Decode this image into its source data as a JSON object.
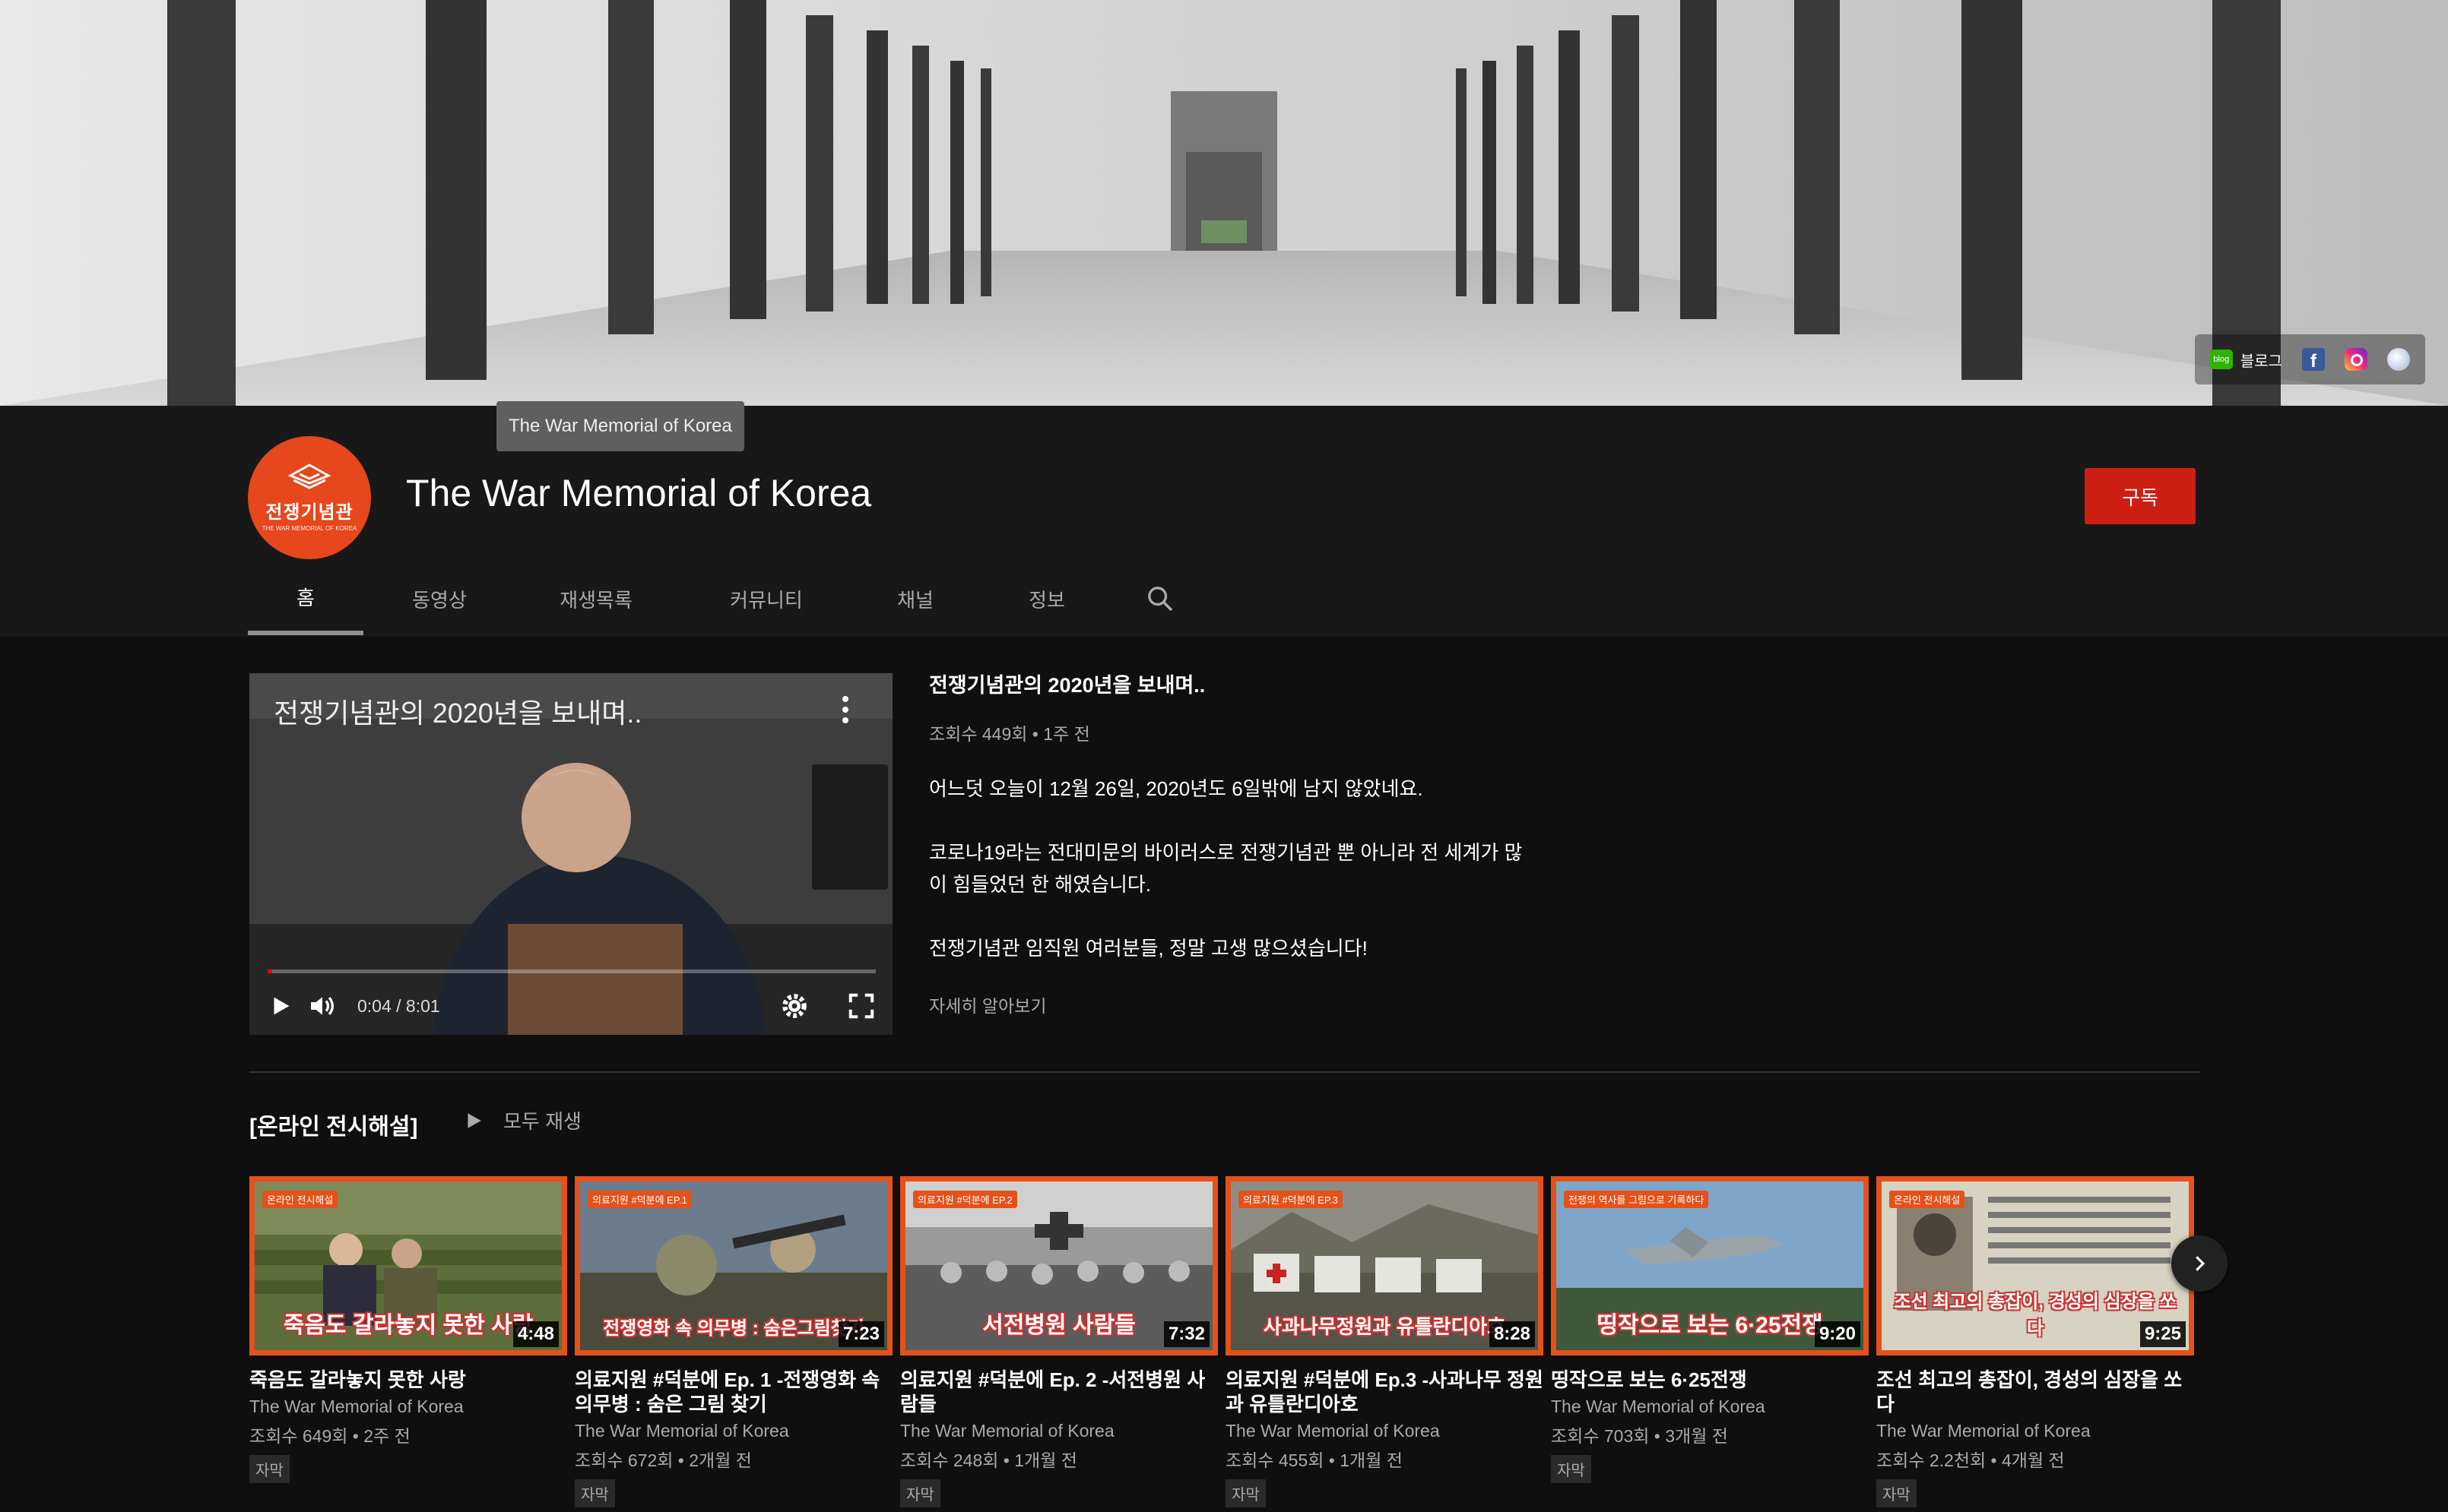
{
  "banner": {
    "links": [
      {
        "label": "블로그",
        "icon": "blog-icon"
      },
      {
        "label": "",
        "icon": "facebook-icon"
      },
      {
        "label": "",
        "icon": "instagram-icon"
      },
      {
        "label": "",
        "icon": "website-icon"
      }
    ],
    "blog_badge": "blog"
  },
  "tooltip": "The War Memorial of Korea",
  "channel": {
    "name": "The War Memorial of Korea",
    "avatar_title": "전쟁기념관",
    "avatar_sub": "THE WAR MEMORIAL OF KOREA",
    "subscribe_label": "구독"
  },
  "tabs": [
    "홈",
    "동영상",
    "재생목록",
    "커뮤니티",
    "채널",
    "정보"
  ],
  "featured": {
    "player_title": "전쟁기념관의 2020년을 보내며..",
    "time": "0:04 / 8:01",
    "progress": 0.008,
    "title": "전쟁기념관의 2020년을 보내며..",
    "meta": "조회수 449회 • 1주 전",
    "description": "어느덧 오늘이 12월 26일, 2020년도 6일밖에 남지 않았네요.\n\n코로나19라는 전대미문의 바이러스로 전쟁기념관 뿐 아니라 전 세계가 많\n이 힘들었던 한 해였습니다.\n\n전쟁기념관 임직원 여러분들, 정말 고생 많으셨습니다!",
    "more_label": "자세히 알아보기"
  },
  "shelf": {
    "title": "[온라인 전시해설]",
    "play_all": "모두 재생"
  },
  "videos": [
    {
      "title": "죽음도 갈라놓지 못한 사랑",
      "channel": "The War Memorial of Korea",
      "meta": "조회수 649회 • 2주 전",
      "badge": "자막",
      "duration": "4:48",
      "thumb_text": "죽음도 갈라놓지 못한 사랑",
      "tag": "온라인 전시해설"
    },
    {
      "title": "의료지원 #덕분에 Ep. 1 -전쟁영화 속 의무병 : 숨은 그림 찾기",
      "channel": "The War Memorial of Korea",
      "meta": "조회수 672회 • 2개월 전",
      "badge": "자막",
      "duration": "7:23",
      "thumb_text": "전쟁영화 속 의무병 : 숨은그림찾기",
      "tag": "의료지원 #덕분에 EP.1"
    },
    {
      "title": "의료지원 #덕분에 Ep. 2 -서전병원 사람들",
      "channel": "The War Memorial of Korea",
      "meta": "조회수 248회 • 1개월 전",
      "badge": "자막",
      "duration": "7:32",
      "thumb_text": "서전병원 사람들",
      "tag": "의료지원 #덕분에 EP.2"
    },
    {
      "title": "의료지원 #덕분에 Ep.3 -사과나무 정원과 유틀란디아호",
      "channel": "The War Memorial of Korea",
      "meta": "조회수 455회 • 1개월 전",
      "badge": "자막",
      "duration": "8:28",
      "thumb_text": "사과나무정원과 유틀란디아호",
      "tag": "의료지원 #덕분에 EP.3"
    },
    {
      "title": "띵작으로 보는 6·25전쟁",
      "channel": "The War Memorial of Korea",
      "meta": "조회수 703회 • 3개월 전",
      "badge": "자막",
      "duration": "9:20",
      "thumb_text": "띵작으로 보는 6·25전쟁",
      "tag": "전쟁의 역사를 그림으로 기록하다"
    },
    {
      "title": "조선 최고의 총잡이, 경성의 심장을 쏘다",
      "channel": "The War Memorial of Korea",
      "meta": "조회수 2.2천회 • 4개월 전",
      "badge": "자막",
      "duration": "9:25",
      "thumb_text": "조선 최고의 총잡이, 경성의 심장을 쏘다",
      "tag": "온라인 전시해설"
    }
  ],
  "colors": {
    "accent": "#cc1e13",
    "thumb_border": "#e4511b",
    "background": "#0f0f0f",
    "header": "#181818"
  }
}
